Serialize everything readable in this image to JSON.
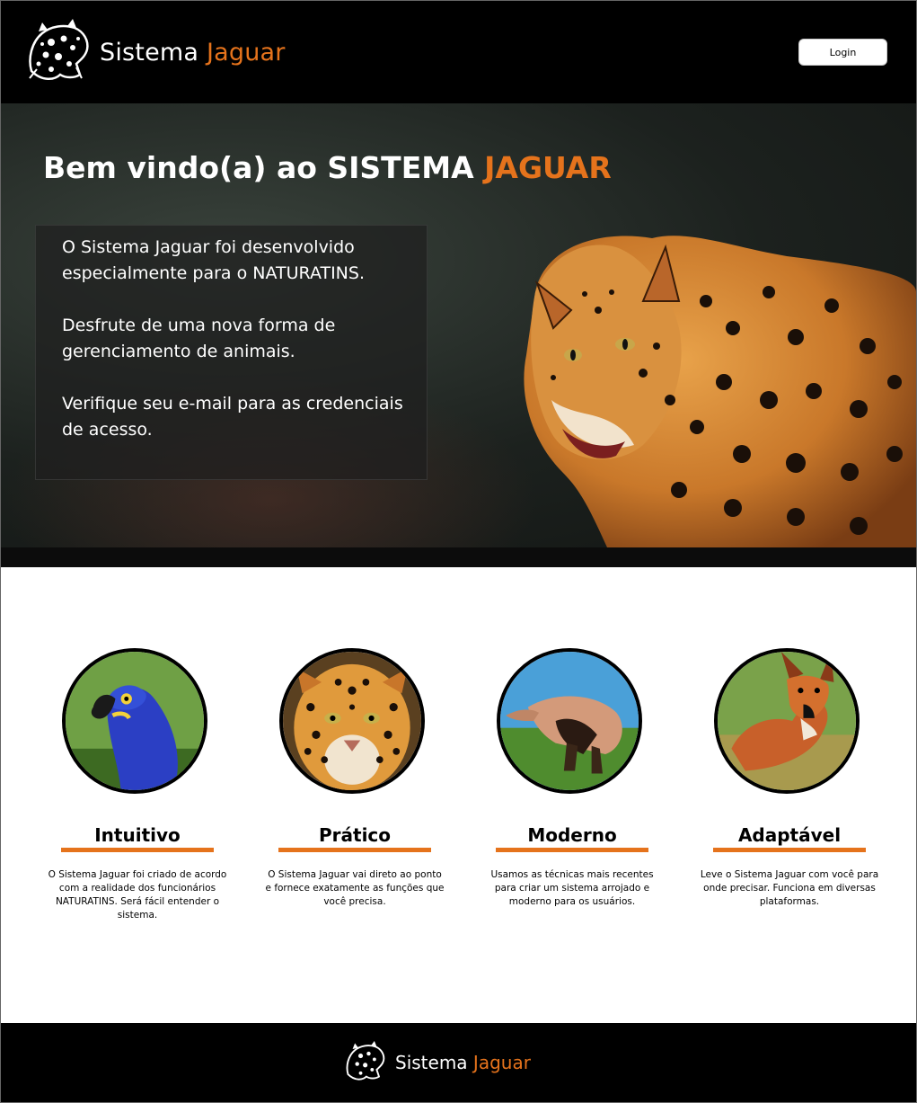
{
  "header": {
    "brand_main": "Sistema",
    "brand_accent": "Jaguar",
    "login_label": "Login"
  },
  "hero": {
    "title_main": "Bem vindo(a) ao SISTEMA",
    "title_accent": "JAGUAR",
    "paragraphs": [
      "O Sistema Jaguar foi desenvolvido especialmente para o NATURATINS.",
      "Desfrute de uma nova forma de gerenciamento de animais.",
      "Verifique seu e-mail para as credenciais de acesso."
    ]
  },
  "features": [
    {
      "title": "Intuitivo",
      "text": "O Sistema Jaguar foi criado de acordo com a realidade dos funcionários NATURATINS. Será fácil entender o sistema."
    },
    {
      "title": "Prático",
      "text": "O Sistema Jaguar vai direto ao ponto e fornece exatamente as funções que você precisa."
    },
    {
      "title": "Moderno",
      "text": "Usamos as técnicas mais recentes para criar um sistema arrojado e moderno para os usuários."
    },
    {
      "title": "Adaptável",
      "text": "Leve o Sistema Jaguar com você para onde precisar. Funciona em diversas plataformas."
    }
  ],
  "footer": {
    "brand_main": "Sistema",
    "brand_accent": "Jaguar"
  },
  "colors": {
    "accent": "#e5731c",
    "header_bg": "#000000",
    "page_bg": "#ffffff"
  },
  "icons": {
    "logo": "jaguar-logo-icon"
  }
}
